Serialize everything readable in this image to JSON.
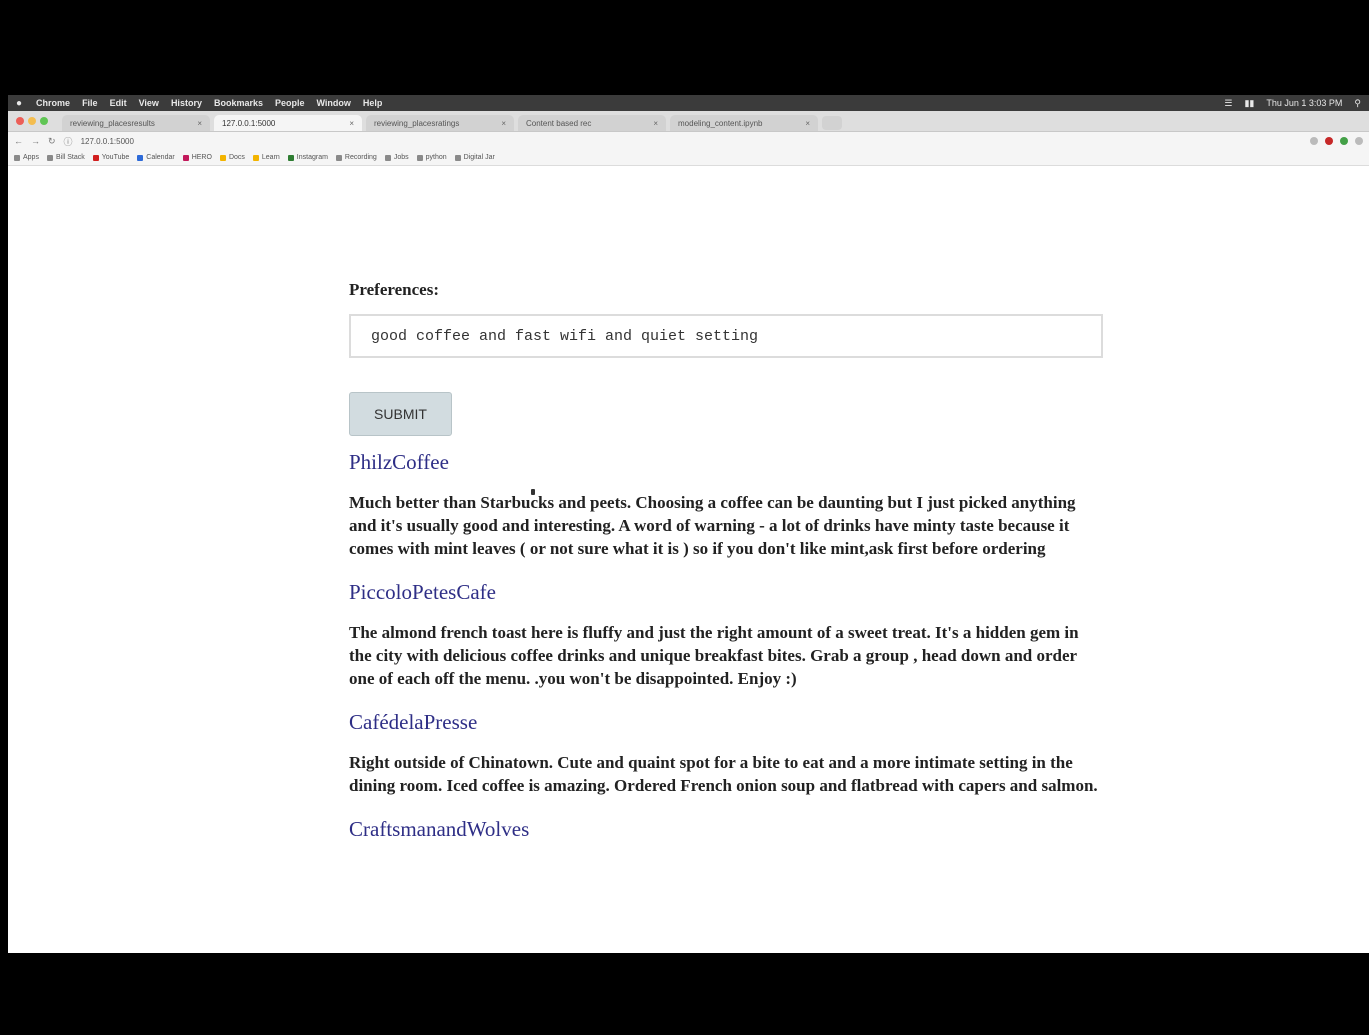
{
  "menubar": {
    "app_name": "Chrome",
    "items": [
      "File",
      "Edit",
      "View",
      "History",
      "Bookmarks",
      "People",
      "Window",
      "Help"
    ],
    "clock": "Thu Jun 1 3:03 PM"
  },
  "tabs": [
    {
      "label": "reviewing_placesresults",
      "active": false
    },
    {
      "label": "127.0.0.1:5000",
      "active": true
    },
    {
      "label": "reviewing_placesratings",
      "active": false
    },
    {
      "label": "Content based rec",
      "active": false
    },
    {
      "label": "modeling_content.ipynb",
      "active": false
    }
  ],
  "toolbar": {
    "address": "127.0.0.1:5000"
  },
  "bookmarks": [
    {
      "label": "Apps",
      "color": "#8a8a8a"
    },
    {
      "label": "Bill Stack",
      "color": "#8a8a8a"
    },
    {
      "label": "YouTube",
      "color": "#d11f1f"
    },
    {
      "label": "Calendar",
      "color": "#2d6ad8"
    },
    {
      "label": "HERO",
      "color": "#c2185b"
    },
    {
      "label": "Docs",
      "color": "#f3b400"
    },
    {
      "label": "Learn",
      "color": "#f3b400"
    },
    {
      "label": "Instagram",
      "color": "#2e7d32"
    },
    {
      "label": "Recording",
      "color": "#8a8a8a"
    },
    {
      "label": "Jobs",
      "color": "#8a8a8a"
    },
    {
      "label": "python",
      "color": "#8a8a8a"
    },
    {
      "label": "Digital Jar",
      "color": "#8a8a8a"
    }
  ],
  "form": {
    "label": "Preferences:",
    "input_value": "good coffee and fast wifi and quiet setting",
    "submit_label": "SUBMIT"
  },
  "results": [
    {
      "name": "PhilzCoffee",
      "review": "Much better than Starbucks and peets. Choosing a coffee can be daunting but I just picked anything and it's usually good and interesting.  A word of warning - a lot of drinks have minty taste because it comes with mint leaves ( or not sure what it is ) so if you don't like mint,ask first before ordering"
    },
    {
      "name": "PiccoloPetesCafe",
      "review": "The almond  french toast  here is fluffy and just the right amount of a  sweet treat. It's a hidden gem in the  city with delicious  coffee drinks and unique breakfast  bites. Grab a group , head down and order one of each off the menu.  .you won't be disappointed. Enjoy :)"
    },
    {
      "name": "CafédelaPresse",
      "review": "Right outside of Chinatown. Cute and quaint spot for a bite to eat and a more intimate setting in the dining room. Iced coffee is amazing. Ordered French onion soup and flatbread with capers and salmon."
    },
    {
      "name": "CraftsmanandWolves",
      "review": ""
    }
  ]
}
